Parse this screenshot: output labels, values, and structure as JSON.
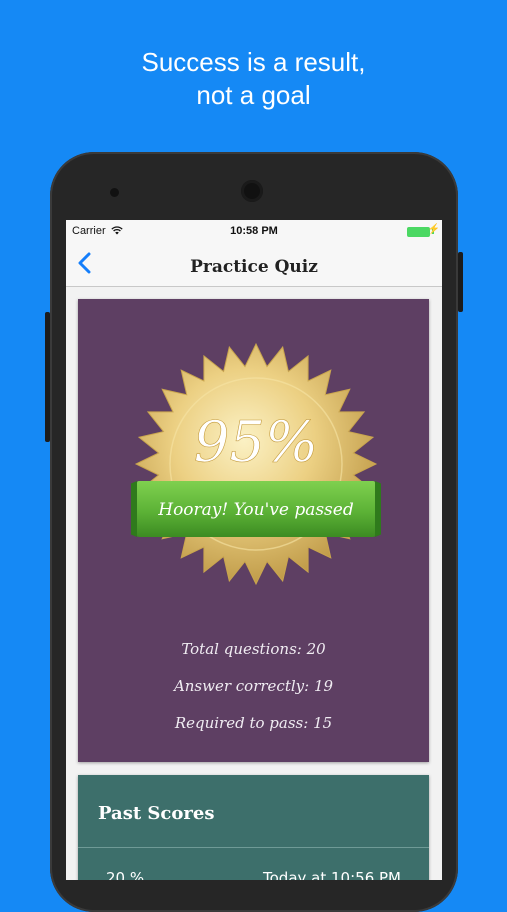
{
  "tagline": {
    "line1": "Success is a result,",
    "line2": "not a goal"
  },
  "status_bar": {
    "carrier": "Carrier",
    "time": "10:58 PM"
  },
  "nav": {
    "title": "Practice Quiz"
  },
  "result": {
    "percent": "95%",
    "banner": "Hooray! You've passed",
    "total_questions": "Total questions: 20",
    "answered_correctly": "Answer correctly: 19",
    "required_to_pass": "Required to pass: 15"
  },
  "past_scores": {
    "title": "Past Scores",
    "rows": [
      {
        "percent": "20 %",
        "date": "Today at 10:56 PM"
      }
    ]
  },
  "colors": {
    "background": "#1589f5",
    "result_card": "#5e3f63",
    "past_card": "#3d6f6b",
    "banner_green": "#5fb83a",
    "seal_gold": "#e8c766",
    "ios_blue": "#147efb"
  },
  "icons": [
    "back-chevron-icon",
    "wifi-icon",
    "battery-icon",
    "charging-bolt-icon",
    "gold-seal-icon"
  ]
}
